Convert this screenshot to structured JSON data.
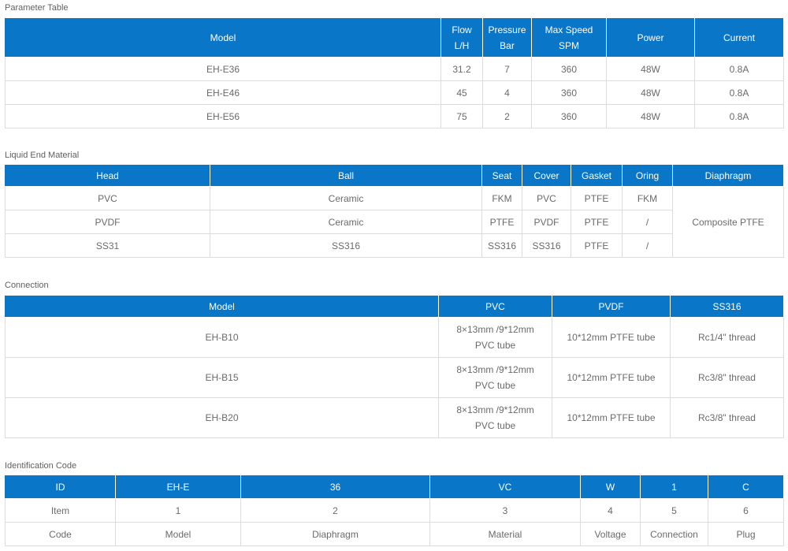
{
  "param_table": {
    "title": "Parameter Table",
    "headers": {
      "model": "Model",
      "flow_1": "Flow",
      "flow_2": "L/H",
      "pressure_1": "Pressure",
      "pressure_2": "Bar",
      "speed_1": "Max Speed",
      "speed_2": "SPM",
      "power": "Power",
      "current": "Current"
    },
    "rows": [
      [
        "EH-E36",
        "31.2",
        "7",
        "360",
        "48W",
        "0.8A"
      ],
      [
        "EH-E46",
        "45",
        "4",
        "360",
        "48W",
        "0.8A"
      ],
      [
        "EH-E56",
        "75",
        "2",
        "360",
        "48W",
        "0.8A"
      ]
    ]
  },
  "liquid_end": {
    "title": "Liquid End Material",
    "headers": [
      "Head",
      "Ball",
      "Seat",
      "Cover",
      "Gasket",
      "Oring",
      "Diaphragm"
    ],
    "rows": [
      [
        "PVC",
        "Ceramic",
        "FKM",
        "PVC",
        "PTFE",
        "FKM"
      ],
      [
        "PVDF",
        "Ceramic",
        "PTFE",
        "PVDF",
        "PTFE",
        "/"
      ],
      [
        "SS31",
        "SS316",
        "SS316",
        "SS316",
        "PTFE",
        "/"
      ]
    ],
    "diaphragm": "Composite PTFE"
  },
  "connection": {
    "title": "Connection",
    "headers": [
      "Model",
      "PVC",
      "PVDF",
      "SS316"
    ],
    "rows": [
      {
        "model": "EH-B10",
        "pvc_1": "8×13mm /9*12mm",
        "pvc_2": "PVC tube",
        "pvdf": "10*12mm PTFE tube",
        "ss316": "Rc1/4\" thread"
      },
      {
        "model": "EH-B15",
        "pvc_1": "8×13mm /9*12mm",
        "pvc_2": "PVC tube",
        "pvdf": "10*12mm PTFE tube",
        "ss316": "Rc3/8\" thread"
      },
      {
        "model": "EH-B20",
        "pvc_1": "8×13mm /9*12mm",
        "pvc_2": "PVC tube",
        "pvdf": "10*12mm PTFE tube",
        "ss316": "Rc3/8\" thread"
      }
    ]
  },
  "id_code": {
    "title": "Identification Code",
    "headers": [
      "ID",
      "EH-E",
      "36",
      "VC",
      "W",
      "1",
      "C"
    ],
    "rows": [
      [
        "Item",
        "1",
        "2",
        "3",
        "4",
        "5",
        "6"
      ],
      [
        "Code",
        "Model",
        "Diaphragm",
        "Material",
        "Voltage",
        "Connection",
        "Plug"
      ]
    ]
  }
}
